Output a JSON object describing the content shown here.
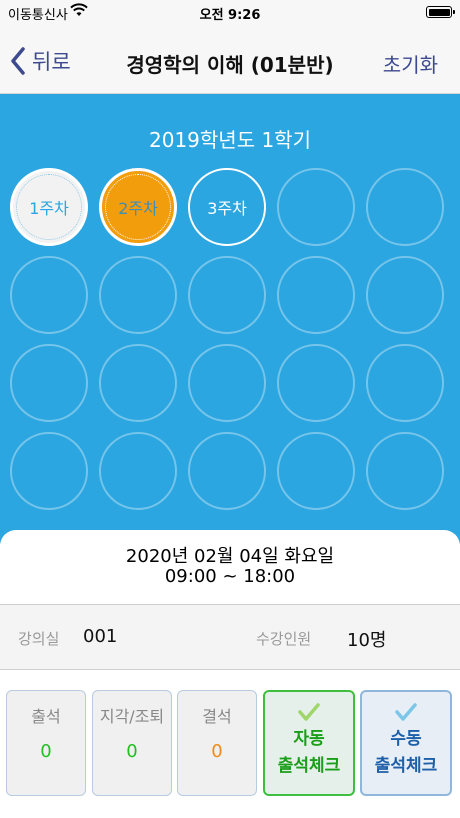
{
  "status_bar": {
    "carrier": "이동통신사",
    "time": "오전 9:26"
  },
  "nav": {
    "back_label": "뒤로",
    "title": "경영학의 이해 (01분반)",
    "reset_label": "초기화"
  },
  "semester": "2019학년도 1학기",
  "weeks": [
    {
      "label": "1주차",
      "state": "done"
    },
    {
      "label": "2주차",
      "state": "current"
    },
    {
      "label": "3주차",
      "state": "next"
    }
  ],
  "empty_week_slots": 17,
  "session": {
    "date": "2020년 02월 04일 화요일",
    "time": "09:00 ~ 18:00"
  },
  "info": {
    "room_label": "강의실",
    "room_value": "001",
    "enroll_label": "수강인원",
    "enroll_value": "10명"
  },
  "stats": [
    {
      "label": "출석",
      "value": "0",
      "color": "#22c022"
    },
    {
      "label": "지각/조퇴",
      "value": "0",
      "color": "#22c022"
    },
    {
      "label": "결석",
      "value": "0",
      "color": "#f08a1a"
    }
  ],
  "actions": {
    "auto": {
      "line1": "자동",
      "line2": "출석체크",
      "color": "#1a9e1a",
      "border": "#3fbf3f",
      "icon": "check-icon"
    },
    "manual": {
      "line1": "수동",
      "line2": "출석체크",
      "color": "#1d5fa8",
      "border": "#8fb6dc",
      "icon": "check-icon"
    }
  },
  "colors": {
    "accent_blue": "#2ba6e0",
    "current_week": "#f29d0c",
    "nav_link": "#3d4a8f"
  }
}
